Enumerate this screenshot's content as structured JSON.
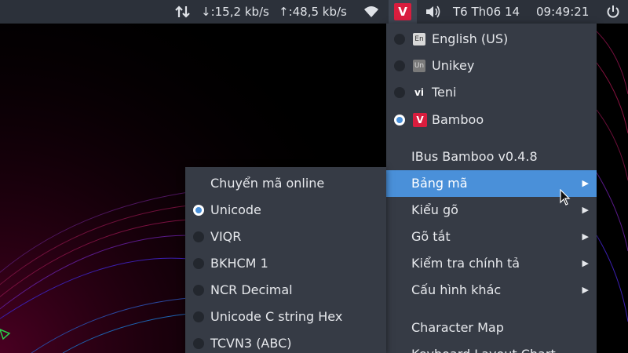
{
  "panel": {
    "download_speed": "↓:15,2 kb/s",
    "upload_speed": "↑:48,5 kb/s",
    "date": "T6 Th06 14",
    "time": "09:49:21",
    "ime_badge": "V"
  },
  "input_methods": [
    {
      "icon_text": "En",
      "label": "English (US)",
      "selected": false
    },
    {
      "icon_text": "Un",
      "label": "Unikey",
      "selected": false
    },
    {
      "icon_text": "vi",
      "label": "Teni",
      "selected": false
    },
    {
      "icon_text": "V",
      "label": "Bamboo",
      "selected": true
    }
  ],
  "main_menu": {
    "version": "IBus Bamboo v0.4.8",
    "items": [
      {
        "label": "Bảng mã",
        "active": true
      },
      {
        "label": "Kiểu gõ",
        "active": false
      },
      {
        "label": "Gõ tắt",
        "active": false
      },
      {
        "label": "Kiểm tra chính tả",
        "active": false
      },
      {
        "label": "Cấu hình khác",
        "active": false
      }
    ],
    "character_map": "Character Map",
    "keyboard_layout_chart": "Keyboard Layout Chart"
  },
  "encoding_menu": {
    "convert_online": "Chuyển mã online",
    "options": [
      {
        "label": "Unicode",
        "selected": true
      },
      {
        "label": "VIQR",
        "selected": false
      },
      {
        "label": "BKHCM 1",
        "selected": false
      },
      {
        "label": "NCR Decimal",
        "selected": false
      },
      {
        "label": "Unicode C string Hex",
        "selected": false
      },
      {
        "label": "TCVN3 (ABC)",
        "selected": false
      }
    ]
  },
  "colors": {
    "accent": "#4a90d9",
    "bamboo_red": "#d91d3e",
    "menu_bg": "#363b45",
    "panel_bg": "#2c313a"
  },
  "icons": {
    "network_transfer": "arrows-up-down-icon",
    "wifi": "wifi-icon",
    "volume": "volume-icon",
    "power": "power-icon",
    "submenu": "chevron-right-icon",
    "cursor": "mouse-pointer-icon"
  }
}
